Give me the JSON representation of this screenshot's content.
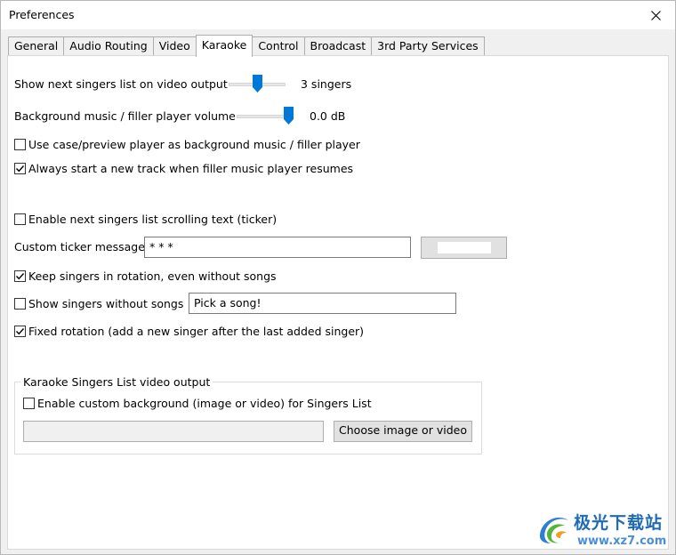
{
  "window": {
    "title": "Preferences",
    "close_icon": "close-icon"
  },
  "tabs": [
    {
      "label": "General",
      "active": false
    },
    {
      "label": "Audio Routing",
      "active": false
    },
    {
      "label": "Video",
      "active": false
    },
    {
      "label": "Karaoke",
      "active": true
    },
    {
      "label": "Control",
      "active": false
    },
    {
      "label": "Broadcast",
      "active": false
    },
    {
      "label": "3rd Party Services",
      "active": false
    }
  ],
  "karaoke": {
    "next_singers": {
      "label": "Show next singers list on video output",
      "value_text": "3 singers",
      "level": 0.5
    },
    "bg_volume": {
      "label": "Background music / filler player volume",
      "value_text": "0.0 dB",
      "level": 1.0
    },
    "use_cue_player": {
      "label": "Use case/preview player as background music / filler player",
      "checked": false
    },
    "always_new_track": {
      "label": "Always start a new track when filler music player resumes",
      "checked": true
    },
    "enable_ticker": {
      "label": "Enable next singers list scrolling text (ticker)",
      "checked": false
    },
    "ticker_message": {
      "label": "Custom ticker message",
      "value": "* * *"
    },
    "ticker_color": "#ffffff",
    "keep_rotation": {
      "label": "Keep singers in rotation, even without songs",
      "checked": true
    },
    "show_without_songs": {
      "label": "Show singers without songs",
      "checked": false,
      "value": "Pick a song!"
    },
    "fixed_rotation": {
      "label": "Fixed rotation (add a new singer after the last added singer)",
      "checked": true
    },
    "singers_list_group": {
      "title": "Karaoke Singers List video output",
      "custom_bg": {
        "label": "Enable custom background (image or video) for Singers List",
        "checked": false
      },
      "path_value": "",
      "choose_label": "Choose image or video"
    }
  },
  "watermark": {
    "name": "极光下载站",
    "url": "www.xz7.com",
    "icon": "aurora-logo-icon"
  },
  "colors": {
    "accent": "#0078d7",
    "checkmark": "#000000"
  }
}
